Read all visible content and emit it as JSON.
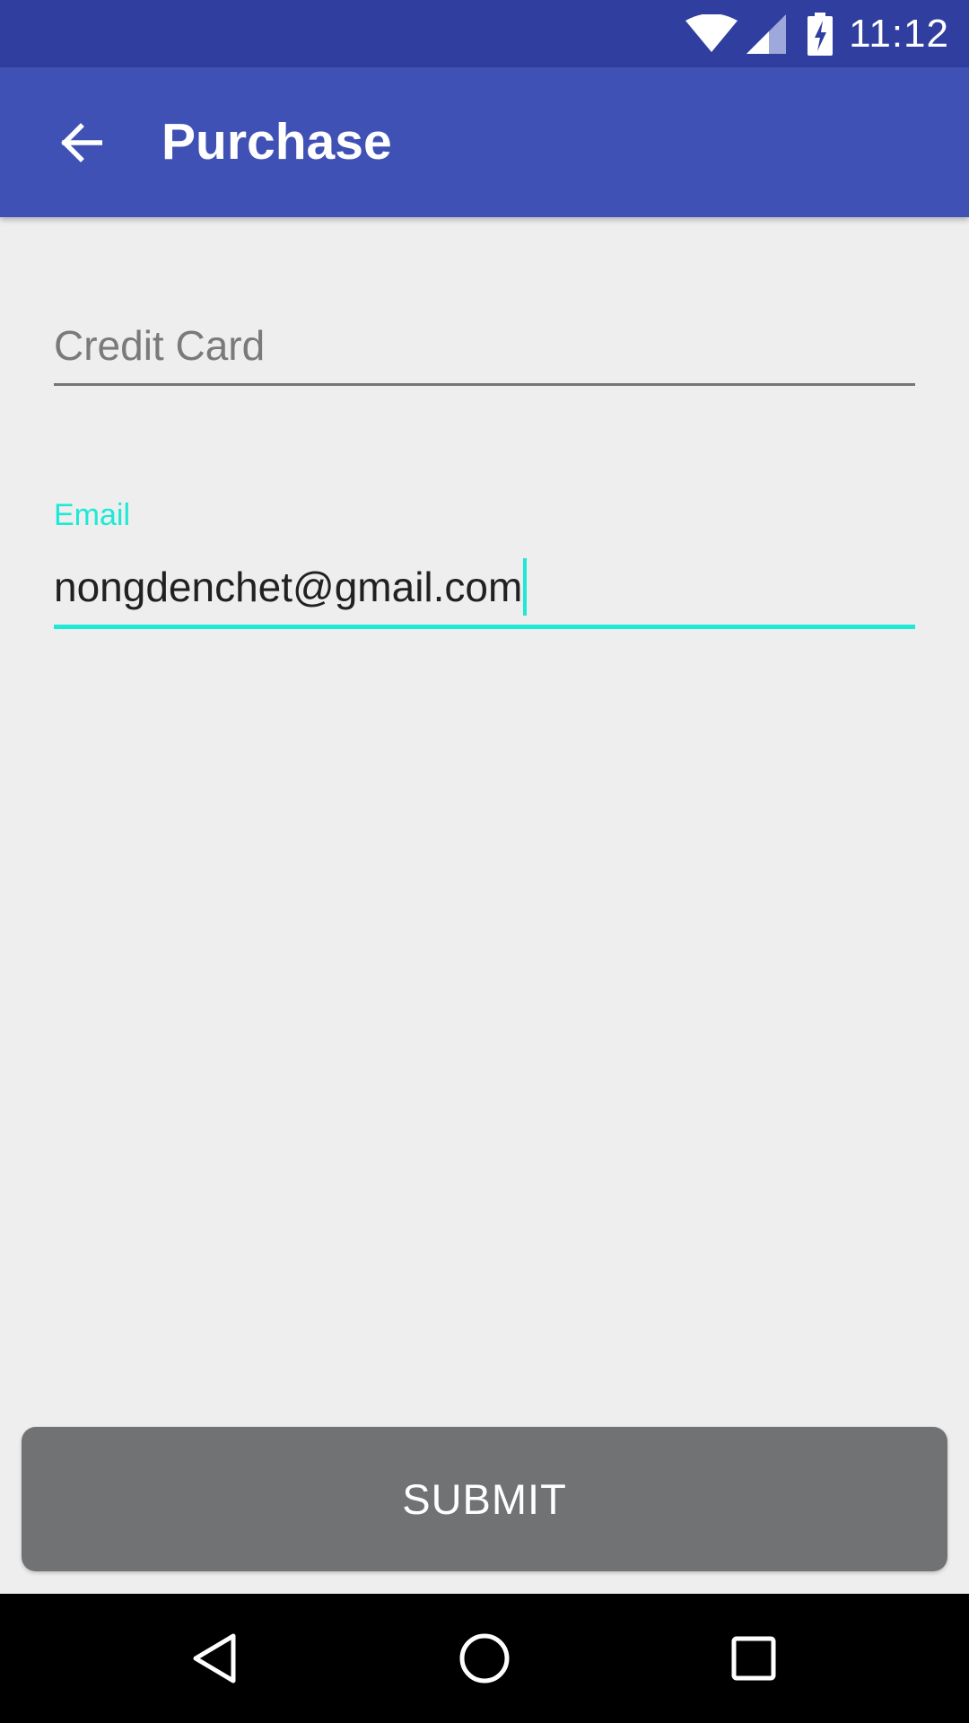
{
  "status_bar": {
    "time": "11:12",
    "icons": [
      "wifi-icon",
      "cell-signal-icon",
      "battery-charging-icon"
    ]
  },
  "app_bar": {
    "title": "Purchase",
    "nav_icon": "arrow-back-icon"
  },
  "form": {
    "credit_card": {
      "placeholder": "Credit Card",
      "value": ""
    },
    "email": {
      "label": "Email",
      "value": "nongdenchet@gmail.com"
    }
  },
  "submit": {
    "label": "SUBMIT"
  },
  "nav_bar": {
    "icons": [
      "back-triangle-icon",
      "home-circle-icon",
      "recents-square-icon"
    ]
  },
  "colors": {
    "status_bar": "#303f9f",
    "app_bar": "#3f51b5",
    "accent": "#1de9d6",
    "background": "#eeeeee",
    "button": "#717273",
    "nav_bar": "#000000"
  }
}
